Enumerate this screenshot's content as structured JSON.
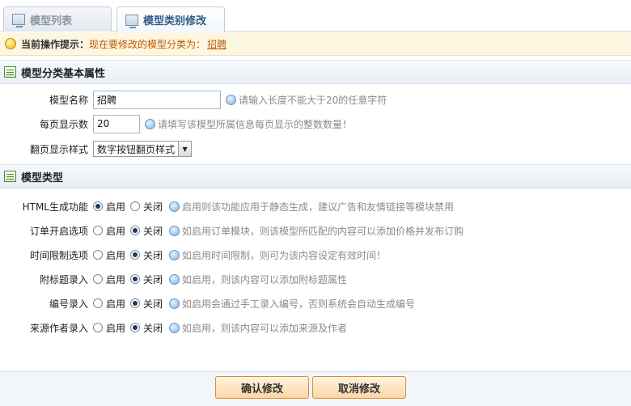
{
  "tabs": [
    {
      "label": "模型列表",
      "active": false
    },
    {
      "label": "模型类别修改",
      "active": true
    }
  ],
  "tip": {
    "label": "当前操作提示：",
    "text": "现在要修改的模型分类为：",
    "value": "招聘"
  },
  "basic_section": {
    "title": "模型分类基本属性",
    "fields": {
      "name": {
        "label": "模型名称",
        "value": "招聘",
        "help": "请输入长度不能大于20的任意字符"
      },
      "per_page": {
        "label": "每页显示数",
        "value": "20",
        "help": "请填写该模型所属信息每页显示的整数数量！"
      },
      "paging": {
        "label": "翻页显示样式",
        "selected": "数字按钮翻页样式"
      }
    }
  },
  "type_section": {
    "title": "模型类型",
    "on_label": "启用",
    "off_label": "关闭",
    "rows": [
      {
        "label": "HTML生成功能",
        "enabled": true,
        "help": "启用则该功能应用于静态生成，建议广告和友情链接等模块禁用"
      },
      {
        "label": "订单开启选项",
        "enabled": false,
        "help": "如启用订单模块，则该模型所匹配的内容可以添加价格并发布订购"
      },
      {
        "label": "时间限制选项",
        "enabled": false,
        "help": "如启用时间限制，则可为该内容设定有效时间！"
      },
      {
        "label": "附标题录入",
        "enabled": false,
        "help": "如启用，则该内容可以添加附标题属性"
      },
      {
        "label": "编号录入",
        "enabled": false,
        "help": "如启用会通过手工录入编号，否则系统会自动生成编号"
      },
      {
        "label": "来源作者录入",
        "enabled": false,
        "help": "如启用，则该内容可以添加来源及作者"
      }
    ]
  },
  "buttons": {
    "confirm": "确认修改",
    "cancel": "取消修改"
  }
}
